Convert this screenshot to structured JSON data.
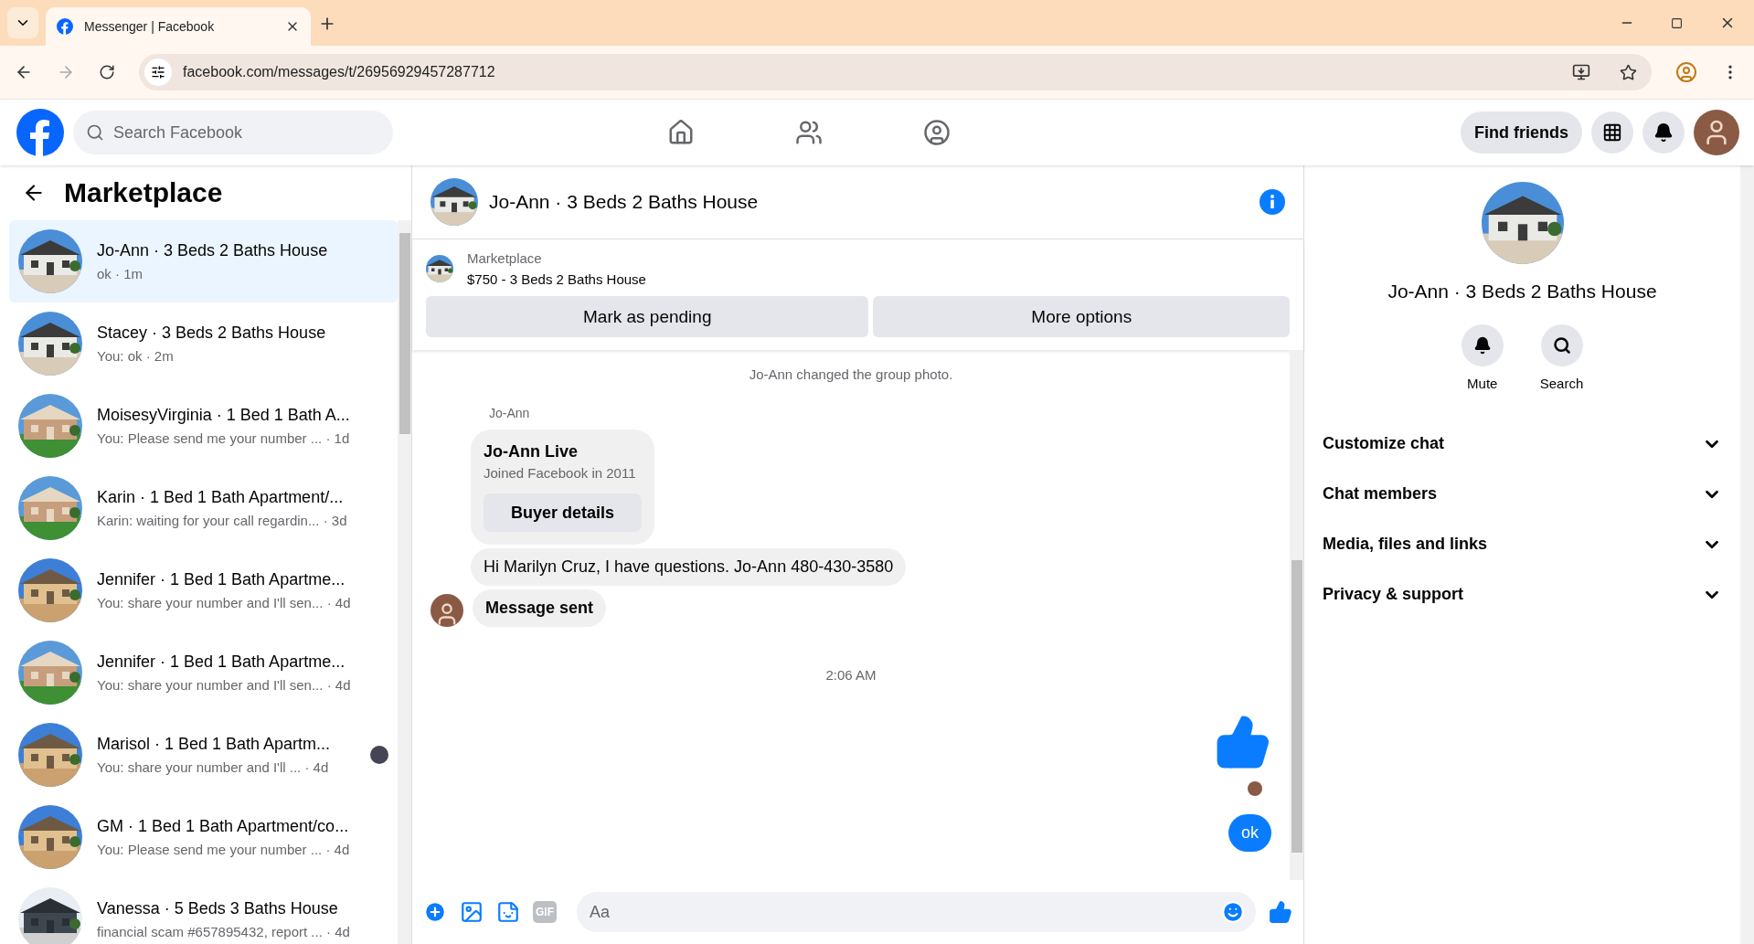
{
  "browser": {
    "tabs": [
      {
        "title": "Messenger | Facebook",
        "selected": true
      }
    ],
    "url": "facebook.com/messages/t/26956929457287712"
  },
  "topbar": {
    "search": {
      "placeholder": "Search Facebook"
    },
    "find_friends": "Find friends"
  },
  "sidebar": {
    "title": "Marketplace",
    "items": [
      {
        "name": "Jo-Ann · 3 Beds 2 Baths House",
        "preview": "ok",
        "time": "· 1m",
        "selected": true
      },
      {
        "name": "Stacey · 3 Beds 2 Baths House",
        "preview": "You: ok",
        "time": "· 2m",
        "selected": false
      },
      {
        "name": "MoisesyVirginia · 1 Bed 1 Bath A...",
        "preview": "You: Please send me your number ...",
        "time": "· 1d",
        "selected": false
      },
      {
        "name": "Karin · 1 Bed 1 Bath Apartment/...",
        "preview": "Karin: waiting for your call regardin...",
        "time": "· 3d",
        "selected": false
      },
      {
        "name": "Jennifer · 1 Bed 1 Bath Apartme...",
        "preview": "You: share your number and I'll sen...",
        "time": "· 4d",
        "selected": false
      },
      {
        "name": "Jennifer · 1 Bed 1 Bath Apartme...",
        "preview": "You: share your number and I'll sen...",
        "time": "· 4d",
        "selected": false
      },
      {
        "name": "Marisol · 1 Bed 1 Bath Apartm...",
        "preview": "You: share your number and I'll ...",
        "time": "· 4d",
        "selected": false,
        "seen": true
      },
      {
        "name": "GM · 1 Bed 1 Bath Apartment/co...",
        "preview": "You: Please send me your number ...",
        "time": "· 4d",
        "selected": false
      },
      {
        "name": "Vanessa · 5 Beds 3 Baths House",
        "preview": "financial scam #657895432, report ...",
        "time": "· 4d",
        "selected": false
      }
    ]
  },
  "chat": {
    "title": "Jo-Ann · 3 Beds 2 Baths House",
    "listing": {
      "label": "Marketplace",
      "title": "$750 - 3 Beds 2 Baths House",
      "actions": [
        "Mark as pending",
        "More options"
      ]
    },
    "messages": [
      {
        "kind": "event",
        "text": "Jo-Ann changed the group photo."
      },
      {
        "kind": "sender",
        "text": "Jo-Ann"
      },
      {
        "kind": "card",
        "title": "Jo-Ann Live",
        "subtitle": "Joined Facebook in 2011",
        "button": "Buyer details"
      },
      {
        "kind": "incoming",
        "text": "Hi Marilyn Cruz, I have questions. Jo-Ann 480-430-3580"
      },
      {
        "kind": "incoming",
        "text": "Message sent",
        "avatar": true
      },
      {
        "kind": "time",
        "text": "2:06 AM"
      },
      {
        "kind": "like"
      },
      {
        "kind": "outgoing",
        "text": "ok"
      }
    ],
    "composer": {
      "placeholder": "Aa",
      "gif": "GIF"
    }
  },
  "details": {
    "name": "Jo-Ann · 3 Beds 2 Baths House",
    "actions": [
      "Mute",
      "Search"
    ],
    "sections": [
      "Customize chat",
      "Chat members",
      "Media, files and links",
      "Privacy & support"
    ]
  }
}
